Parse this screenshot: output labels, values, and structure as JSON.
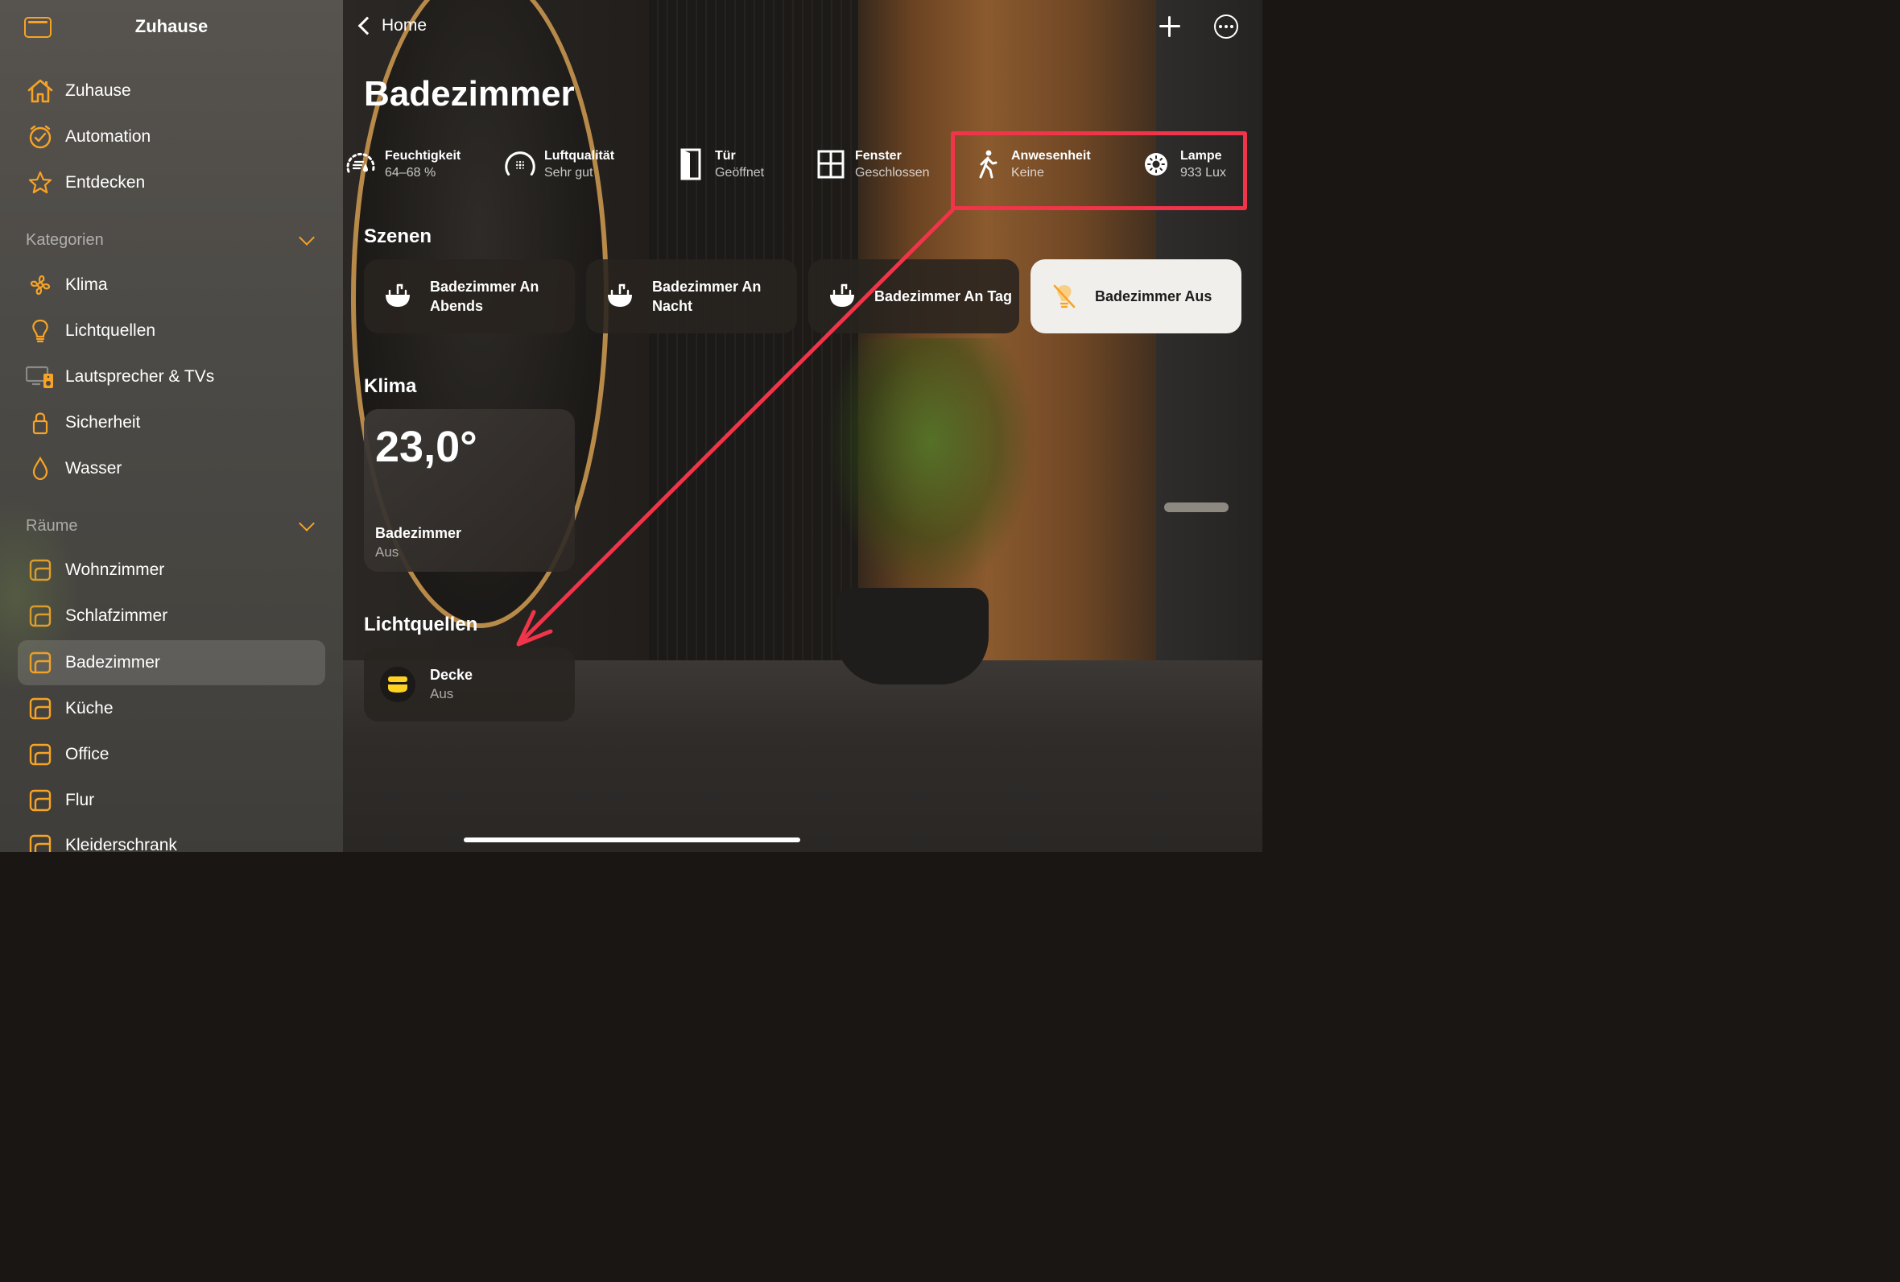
{
  "sidebar": {
    "title": "Zuhause",
    "main_items": [
      {
        "label": "Zuhause",
        "icon": "house-icon"
      },
      {
        "label": "Automation",
        "icon": "clock-check-icon"
      },
      {
        "label": "Entdecken",
        "icon": "star-icon"
      }
    ],
    "categories_header": "Kategorien",
    "categories": [
      {
        "label": "Klima",
        "icon": "fan-icon"
      },
      {
        "label": "Lichtquellen",
        "icon": "lightbulb-icon"
      },
      {
        "label": "Lautsprecher & TVs",
        "icon": "speaker-tv-icon"
      },
      {
        "label": "Sicherheit",
        "icon": "lock-icon"
      },
      {
        "label": "Wasser",
        "icon": "drop-icon"
      }
    ],
    "rooms_header": "Räume",
    "rooms": [
      {
        "label": "Wohnzimmer"
      },
      {
        "label": "Schlafzimmer"
      },
      {
        "label": "Badezimmer",
        "active": true
      },
      {
        "label": "Küche"
      },
      {
        "label": "Office"
      },
      {
        "label": "Flur"
      },
      {
        "label": "Kleiderschrank"
      }
    ],
    "accent": "#f7a325"
  },
  "header": {
    "back_label": "Home",
    "title": "Badezimmer"
  },
  "status": [
    {
      "name": "Feuchtigkeit",
      "value": "64–68 %",
      "icon": "humidity-icon"
    },
    {
      "name": "Luftqualität",
      "value": "Sehr gut",
      "icon": "air-quality-icon"
    },
    {
      "name": "Tür",
      "value": "Geöffnet",
      "icon": "door-icon"
    },
    {
      "name": "Fenster",
      "value": "Geschlossen",
      "icon": "window-icon"
    },
    {
      "name": "Anwesenheit",
      "value": "Keine",
      "icon": "walking-person-icon"
    },
    {
      "name": "Lampe",
      "value": "933 Lux",
      "icon": "sun-icon"
    }
  ],
  "scenes_title": "Szenen",
  "scenes": [
    {
      "label": "Badezimmer An Abends",
      "icon": "sink-icon"
    },
    {
      "label": "Badezimmer An Nacht",
      "icon": "sink-icon"
    },
    {
      "label": "Badezimmer An Tag",
      "icon": "sink-icon"
    },
    {
      "label": "Badezimmer Aus",
      "icon": "lightbulb-off-icon"
    }
  ],
  "klima_title": "Klima",
  "klima": {
    "temperature": "23,0°",
    "name": "Badezimmer",
    "state": "Aus"
  },
  "lights_title": "Lichtquellen",
  "lights": [
    {
      "name": "Decke",
      "state": "Aus",
      "icon": "ceiling-light-icon"
    }
  ],
  "colors": {
    "highlight": "#f0344a",
    "accent": "#f7a325",
    "light_icon": "#ffd21f"
  }
}
